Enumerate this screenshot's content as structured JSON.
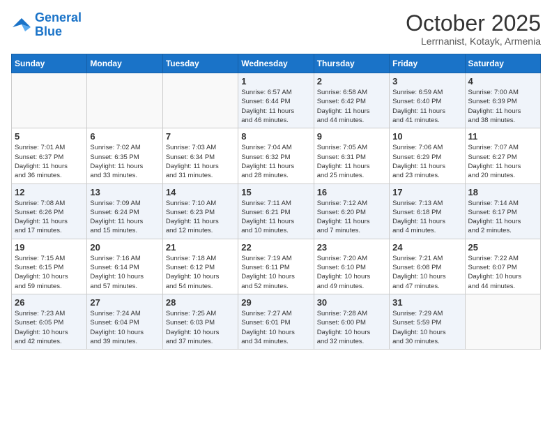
{
  "header": {
    "logo_line1": "General",
    "logo_line2": "Blue",
    "month": "October 2025",
    "location": "Lerrnanist, Kotayk, Armenia"
  },
  "weekdays": [
    "Sunday",
    "Monday",
    "Tuesday",
    "Wednesday",
    "Thursday",
    "Friday",
    "Saturday"
  ],
  "weeks": [
    [
      {
        "day": "",
        "info": ""
      },
      {
        "day": "",
        "info": ""
      },
      {
        "day": "",
        "info": ""
      },
      {
        "day": "1",
        "info": "Sunrise: 6:57 AM\nSunset: 6:44 PM\nDaylight: 11 hours\nand 46 minutes."
      },
      {
        "day": "2",
        "info": "Sunrise: 6:58 AM\nSunset: 6:42 PM\nDaylight: 11 hours\nand 44 minutes."
      },
      {
        "day": "3",
        "info": "Sunrise: 6:59 AM\nSunset: 6:40 PM\nDaylight: 11 hours\nand 41 minutes."
      },
      {
        "day": "4",
        "info": "Sunrise: 7:00 AM\nSunset: 6:39 PM\nDaylight: 11 hours\nand 38 minutes."
      }
    ],
    [
      {
        "day": "5",
        "info": "Sunrise: 7:01 AM\nSunset: 6:37 PM\nDaylight: 11 hours\nand 36 minutes."
      },
      {
        "day": "6",
        "info": "Sunrise: 7:02 AM\nSunset: 6:35 PM\nDaylight: 11 hours\nand 33 minutes."
      },
      {
        "day": "7",
        "info": "Sunrise: 7:03 AM\nSunset: 6:34 PM\nDaylight: 11 hours\nand 31 minutes."
      },
      {
        "day": "8",
        "info": "Sunrise: 7:04 AM\nSunset: 6:32 PM\nDaylight: 11 hours\nand 28 minutes."
      },
      {
        "day": "9",
        "info": "Sunrise: 7:05 AM\nSunset: 6:31 PM\nDaylight: 11 hours\nand 25 minutes."
      },
      {
        "day": "10",
        "info": "Sunrise: 7:06 AM\nSunset: 6:29 PM\nDaylight: 11 hours\nand 23 minutes."
      },
      {
        "day": "11",
        "info": "Sunrise: 7:07 AM\nSunset: 6:27 PM\nDaylight: 11 hours\nand 20 minutes."
      }
    ],
    [
      {
        "day": "12",
        "info": "Sunrise: 7:08 AM\nSunset: 6:26 PM\nDaylight: 11 hours\nand 17 minutes."
      },
      {
        "day": "13",
        "info": "Sunrise: 7:09 AM\nSunset: 6:24 PM\nDaylight: 11 hours\nand 15 minutes."
      },
      {
        "day": "14",
        "info": "Sunrise: 7:10 AM\nSunset: 6:23 PM\nDaylight: 11 hours\nand 12 minutes."
      },
      {
        "day": "15",
        "info": "Sunrise: 7:11 AM\nSunset: 6:21 PM\nDaylight: 11 hours\nand 10 minutes."
      },
      {
        "day": "16",
        "info": "Sunrise: 7:12 AM\nSunset: 6:20 PM\nDaylight: 11 hours\nand 7 minutes."
      },
      {
        "day": "17",
        "info": "Sunrise: 7:13 AM\nSunset: 6:18 PM\nDaylight: 11 hours\nand 4 minutes."
      },
      {
        "day": "18",
        "info": "Sunrise: 7:14 AM\nSunset: 6:17 PM\nDaylight: 11 hours\nand 2 minutes."
      }
    ],
    [
      {
        "day": "19",
        "info": "Sunrise: 7:15 AM\nSunset: 6:15 PM\nDaylight: 10 hours\nand 59 minutes."
      },
      {
        "day": "20",
        "info": "Sunrise: 7:16 AM\nSunset: 6:14 PM\nDaylight: 10 hours\nand 57 minutes."
      },
      {
        "day": "21",
        "info": "Sunrise: 7:18 AM\nSunset: 6:12 PM\nDaylight: 10 hours\nand 54 minutes."
      },
      {
        "day": "22",
        "info": "Sunrise: 7:19 AM\nSunset: 6:11 PM\nDaylight: 10 hours\nand 52 minutes."
      },
      {
        "day": "23",
        "info": "Sunrise: 7:20 AM\nSunset: 6:10 PM\nDaylight: 10 hours\nand 49 minutes."
      },
      {
        "day": "24",
        "info": "Sunrise: 7:21 AM\nSunset: 6:08 PM\nDaylight: 10 hours\nand 47 minutes."
      },
      {
        "day": "25",
        "info": "Sunrise: 7:22 AM\nSunset: 6:07 PM\nDaylight: 10 hours\nand 44 minutes."
      }
    ],
    [
      {
        "day": "26",
        "info": "Sunrise: 7:23 AM\nSunset: 6:05 PM\nDaylight: 10 hours\nand 42 minutes."
      },
      {
        "day": "27",
        "info": "Sunrise: 7:24 AM\nSunset: 6:04 PM\nDaylight: 10 hours\nand 39 minutes."
      },
      {
        "day": "28",
        "info": "Sunrise: 7:25 AM\nSunset: 6:03 PM\nDaylight: 10 hours\nand 37 minutes."
      },
      {
        "day": "29",
        "info": "Sunrise: 7:27 AM\nSunset: 6:01 PM\nDaylight: 10 hours\nand 34 minutes."
      },
      {
        "day": "30",
        "info": "Sunrise: 7:28 AM\nSunset: 6:00 PM\nDaylight: 10 hours\nand 32 minutes."
      },
      {
        "day": "31",
        "info": "Sunrise: 7:29 AM\nSunset: 5:59 PM\nDaylight: 10 hours\nand 30 minutes."
      },
      {
        "day": "",
        "info": ""
      }
    ]
  ]
}
